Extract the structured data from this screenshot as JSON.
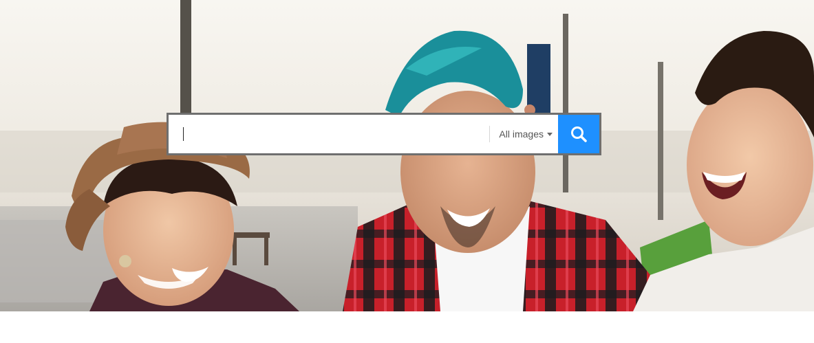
{
  "search": {
    "query": "",
    "placeholder": "",
    "scope_label": "All images",
    "button_icon": "search-icon",
    "accent_color": "#1e90ff"
  },
  "hero": {
    "description_icon": "people-laughing-photo"
  }
}
